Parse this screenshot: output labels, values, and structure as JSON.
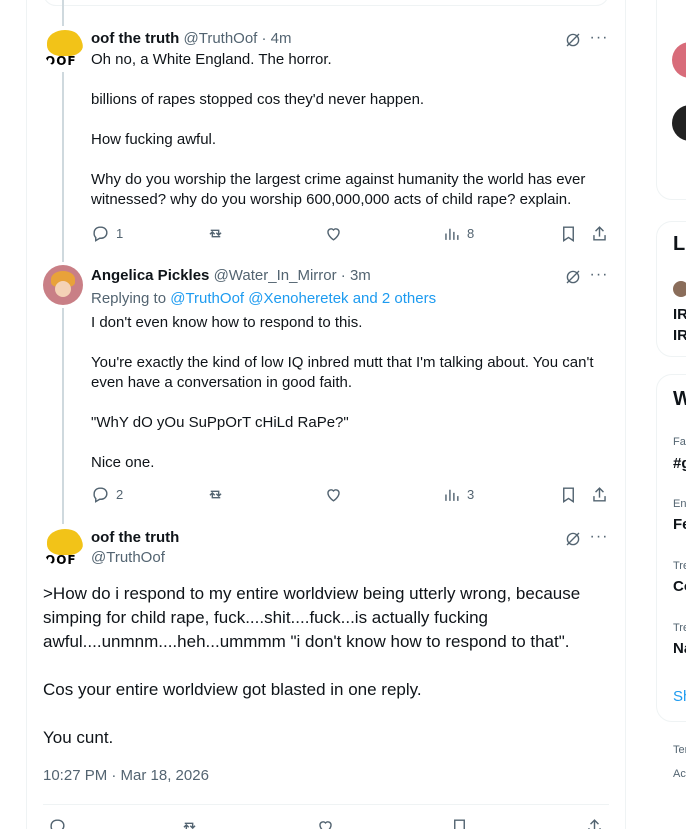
{
  "tweets": [
    {
      "name": "oof the truth",
      "handle": "@TruthOof",
      "time": "· 4m",
      "lines": [
        "Oh no, a White England. The horror.",
        "",
        "billions of rapes stopped cos they'd never happen.",
        "",
        "How fucking awful.",
        "",
        "Why do you worship the largest crime against humanity the world has ever witnessed? why do you worship 600,000,000 acts of child rape? explain."
      ],
      "replies": "1",
      "reposts": "",
      "likes": "",
      "views": "8"
    },
    {
      "name": "Angelica Pickles",
      "handle": "@Water_In_Mirror",
      "time": "· 3m",
      "replying_prefix": "Replying to",
      "replying_links": "@TruthOof @Xenoheretek and 2 others",
      "lines": [
        "I don't even know how to respond to this.",
        "",
        "You're exactly the kind of low IQ inbred mutt that I'm talking about. You can't even have a conversation in good faith.",
        "",
        "\"WhY dO yOu SuPpOrT cHiLd RaPe?\"",
        "",
        "Nice one."
      ],
      "replies": "2",
      "reposts": "",
      "likes": "",
      "views": "3"
    }
  ],
  "main_tweet": {
    "name": "oof the truth",
    "handle": "@TruthOof",
    "lines": [
      ">How do i respond to my entire worldview being utterly wrong, because simping for child rape, fuck....shit....fuck...is actually fucking awful....unmnm....heh...ummmm \"i don't know how to respond to that\".",
      "",
      "Cos your entire worldview got blasted in one reply.",
      "",
      "You cunt."
    ],
    "timestamp": "10:27 PM · Mar 18, 2026"
  },
  "sidebar": {
    "lists_heading_partial": "Li",
    "list_line1": "IR",
    "list_line2": "IR",
    "whats_heading_partial": "W",
    "trends": [
      {
        "small": "Fa",
        "big": "#g"
      },
      {
        "small": "En",
        "big": "Fe"
      },
      {
        "small": "Tre",
        "big": "Co"
      },
      {
        "small": "Tre",
        "big": "Na"
      }
    ],
    "show_more_partial": "Sh",
    "footer1": "Ter",
    "footer2": "Acc"
  },
  "avatar_text": "OOF"
}
